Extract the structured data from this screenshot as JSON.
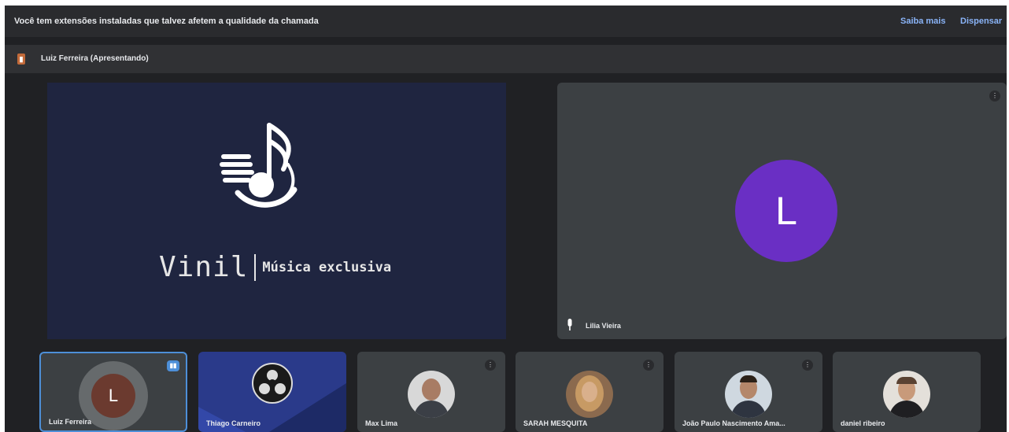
{
  "notice": {
    "text": "Você tem extensões instaladas que talvez afetem a qualidade da chamada",
    "more_label": "Saiba mais",
    "dismiss_label": "Dispensar"
  },
  "presenting": {
    "icon": "presentation-icon",
    "label": "Luiz Ferreira (Apresentando)"
  },
  "presentation": {
    "logo_icon": "music-note-logo-icon",
    "brand_name": "Vinil",
    "tagline": "Música exclusiva"
  },
  "main_participant": {
    "initial": "L",
    "name": "Lilia Vieira",
    "avatar_color": "#6a2fc4",
    "mic_icon": "microphone-icon",
    "more_icon": "more-options-icon"
  },
  "participants": [
    {
      "name": "Luiz Ferreira",
      "initial": "L",
      "avatar_color": "#6b3a2f",
      "speaking": true
    },
    {
      "name": "Thiago Carneiro",
      "avatar": "obs-icon"
    },
    {
      "name": "Max Lima"
    },
    {
      "name": "SARAH MESQUITA"
    },
    {
      "name": "João Paulo Nascimento Ama..."
    },
    {
      "name": "daniel ribeiro"
    }
  ],
  "colors": {
    "background": "#202124",
    "tile": "#3c4043",
    "accent": "#8ab4f8",
    "active_border": "#4d8fd8",
    "presentation_bg": "#1f2540"
  }
}
